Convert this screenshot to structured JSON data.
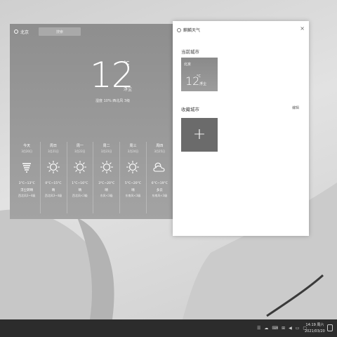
{
  "weather_window": {
    "city": "北京",
    "search_label": "搜索",
    "temperature": "12",
    "unit": "°C",
    "condition": "浮尘",
    "stats": "湿度 10%   西北风 3级"
  },
  "forecast": [
    {
      "day": "今天",
      "date": "3月20日",
      "icon": "sandstorm-icon",
      "range": "3°C~13°C",
      "cond": "浮尘转晴",
      "wind": "西北风3~4级"
    },
    {
      "day": "周日",
      "date": "3月21日",
      "icon": "sun-icon",
      "range": "0°C~15°C",
      "cond": "晴",
      "wind": "西北风3~4级"
    },
    {
      "day": "周一",
      "date": "3月22日",
      "icon": "sun-icon",
      "range": "1°C~16°C",
      "cond": "晴",
      "wind": "西北风<3级"
    },
    {
      "day": "周二",
      "date": "3月23日",
      "icon": "sun-icon",
      "range": "3°C~20°C",
      "cond": "晴",
      "wind": "东风<3级"
    },
    {
      "day": "周三",
      "date": "3月24日",
      "icon": "sun-icon",
      "range": "5°C~20°C",
      "cond": "晴",
      "wind": "东南风<3级"
    },
    {
      "day": "周四",
      "date": "3月25日",
      "icon": "cloudy-icon",
      "range": "6°C~19°C",
      "cond": "多云",
      "wind": "东南风<3级"
    }
  ],
  "city_panel": {
    "title": "麒麟天气",
    "close": "×",
    "current_city_label": "当前城市",
    "current_card": {
      "city": "北京",
      "temp": "12",
      "unit": "°C",
      "cond": "浮尘"
    },
    "favorites_label": "收藏城市",
    "edit_label": "编辑",
    "add": "+"
  },
  "taskbar": {
    "time": "14:19 周六",
    "date": "2021/03/20",
    "tray_icons": [
      "clipboard-icon",
      "weather-tray-icon",
      "keyboard-icon",
      "network-icon",
      "volume-icon",
      "battery-icon",
      "chat-icon"
    ]
  }
}
